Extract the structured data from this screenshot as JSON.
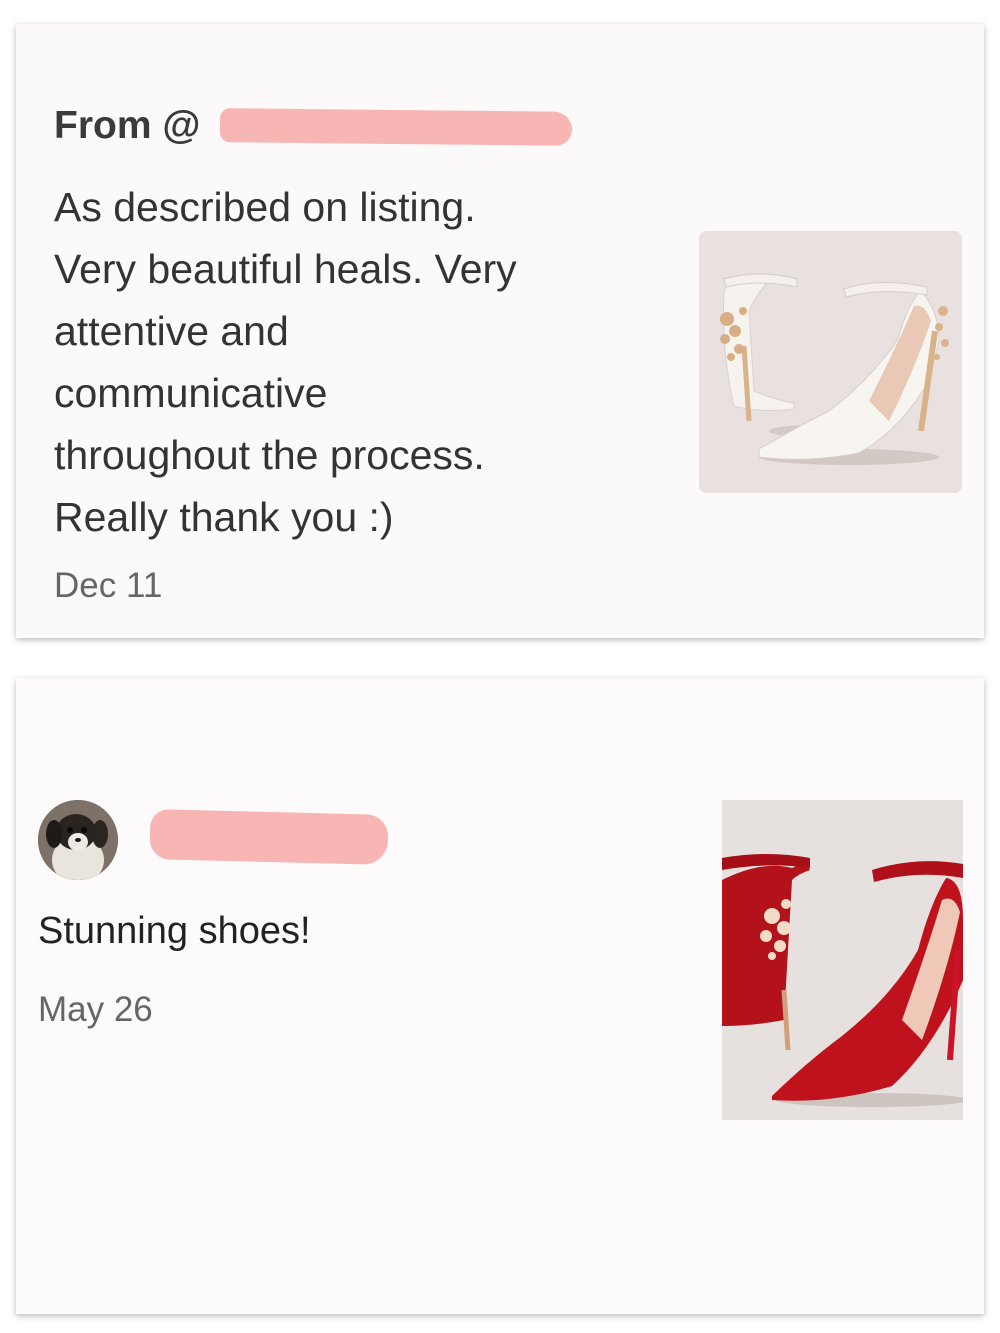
{
  "review1": {
    "from_label": "From @",
    "text": "As described on listing.\nVery beautiful heals. Very\nattentive and\ncommunicative\nthroughout the process.\nReally thank you :)",
    "date": "Dec 11",
    "photo_icon": "white-satin-heels-photo"
  },
  "review2": {
    "avatar_icon": "dog-avatar-photo",
    "text": "Stunning shoes!",
    "date": "May 26",
    "photo_icon": "red-satin-heels-photo"
  },
  "colors": {
    "redaction": "#f7b5b4",
    "card_background": "#fbf9fa",
    "text": "#333333",
    "date_text": "#666666"
  }
}
